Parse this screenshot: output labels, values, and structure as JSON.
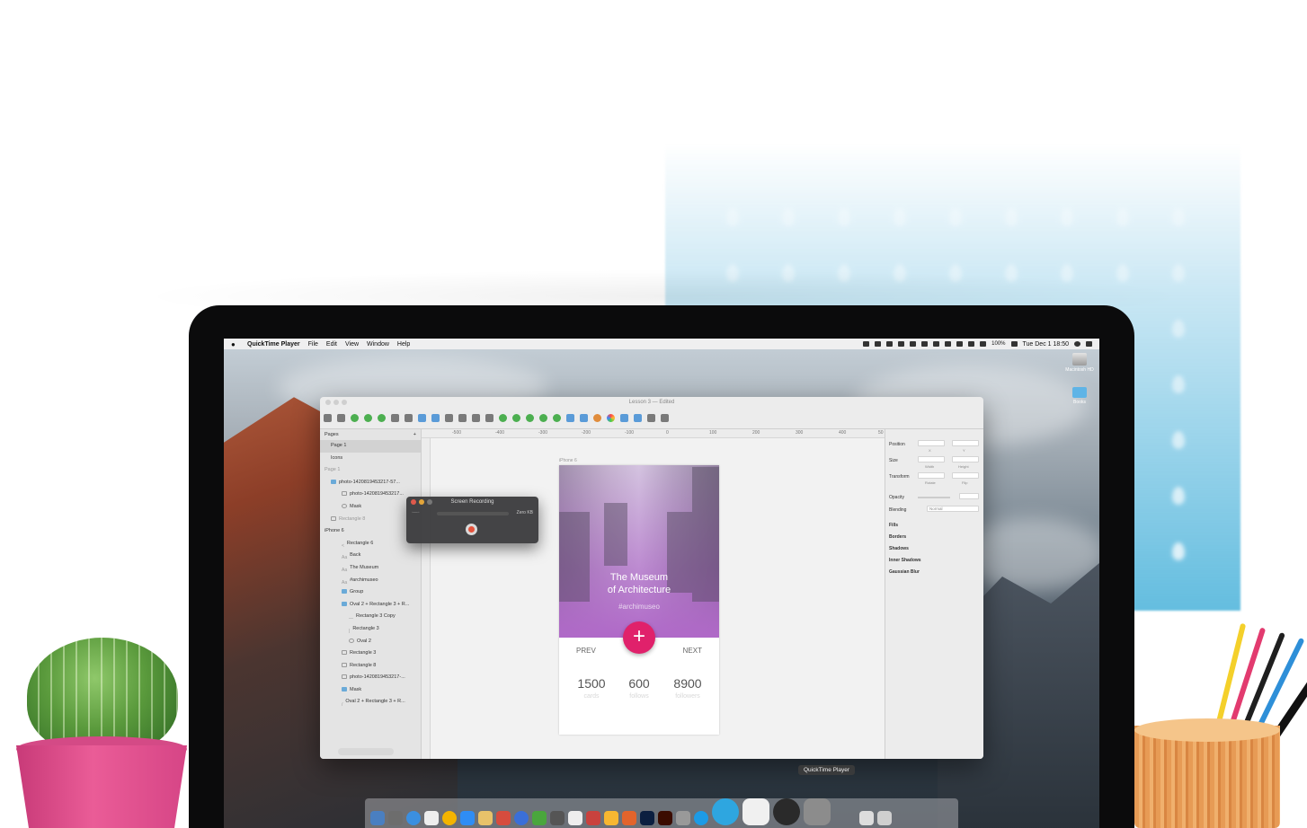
{
  "menubar": {
    "app_name": "QuickTime Player",
    "items": [
      "File",
      "Edit",
      "View",
      "Window",
      "Help"
    ],
    "battery": "100%",
    "clock": "Tue Dec 1  18:50"
  },
  "desktop": {
    "hd_label": "Macintosh HD",
    "folder_label": "Books"
  },
  "sketch": {
    "title": "Lesson 3 — Edited",
    "sidebar": {
      "pages_header": "Pages",
      "pages": [
        "Page 1",
        "Icons"
      ],
      "current_page": "Page 1",
      "layers": [
        "photo-1420819453217-57...",
        "photo-1420819453217...",
        "Mask",
        "Rectangle 8",
        "iPhone 6",
        "Rectangle 6",
        "Back",
        "The Museum",
        "#archimuseo",
        "Group",
        "Oval 2 + Rectangle 3 + R...",
        "Rectangle 3 Copy",
        "Rectangle 3",
        "Oval 2",
        "Rectangle 3",
        "Rectangle 8",
        "photo-1420819453217-...",
        "Mask",
        "Oval 2 + Rectangle 3 + R..."
      ]
    },
    "ruler_ticks": [
      "-500",
      "-400",
      "-300",
      "-200",
      "-100",
      "0",
      "100",
      "200",
      "300",
      "400",
      "50"
    ],
    "artboard": {
      "label": "iPhone 6",
      "title_line1": "The Museum",
      "title_line2": "of Architecture",
      "tag": "#archimuseo",
      "fab": "+",
      "prev": "PREV",
      "next": "NEXT",
      "stats": [
        {
          "value": "1500",
          "label": "cards"
        },
        {
          "value": "600",
          "label": "follows"
        },
        {
          "value": "8900",
          "label": "followers"
        }
      ]
    },
    "inspector": {
      "position": "Position",
      "size": "Size",
      "transform": "Transform",
      "opacity": "Opacity",
      "blending": "Blending",
      "blending_value": "Normal",
      "x": "X",
      "y": "Y",
      "width": "Width",
      "height": "Height",
      "rotate": "Rotate",
      "flip": "Flip",
      "sections": [
        "Fills",
        "Borders",
        "Shadows",
        "Inner Shadows",
        "Gaussian Blur"
      ]
    }
  },
  "recording": {
    "title": "Screen Recording",
    "size": "Zero KB"
  },
  "dock": {
    "tooltip": "QuickTime Player"
  }
}
